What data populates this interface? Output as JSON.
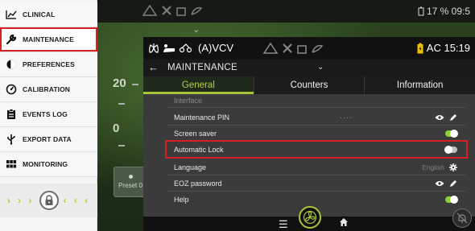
{
  "background_screen": {
    "status_text": "17 % 09:5",
    "gauge_numbers": [
      "20",
      "0"
    ],
    "preset_label": "Preset 0"
  },
  "left_menu": {
    "items": [
      {
        "label": "CLINICAL",
        "icon": "line-chart-icon"
      },
      {
        "label": "MAINTENANCE",
        "icon": "wrench-icon",
        "active": true
      },
      {
        "label": "PREFERENCES",
        "icon": "preferences-icon"
      },
      {
        "label": "CALIBRATION",
        "icon": "calibration-icon"
      },
      {
        "label": "EVENTS LOG",
        "icon": "clipboard-icon"
      },
      {
        "label": "EXPORT DATA",
        "icon": "usb-icon"
      },
      {
        "label": "MONITORING",
        "icon": "grid-icon"
      }
    ],
    "lock": {
      "left_chevrons": "› › ›",
      "right_chevrons": "‹ ‹ ‹"
    }
  },
  "panel": {
    "status_bar": {
      "mode": "(A)VCV",
      "power": "AC 15:19"
    },
    "title": "MAINTENANCE",
    "tabs": [
      {
        "label": "General",
        "active": true
      },
      {
        "label": "Counters",
        "active": false
      },
      {
        "label": "Information",
        "active": false
      }
    ],
    "rows": [
      {
        "label": "Interface",
        "muted": true
      },
      {
        "label": "Maintenance PIN",
        "mid": "····",
        "controls": [
          "eye-icon",
          "pencil-icon"
        ]
      },
      {
        "label": "Screen saver",
        "toggle": "on"
      },
      {
        "label": "Automatic Lock",
        "toggle": "off",
        "highlighted": true
      },
      {
        "label": "Language",
        "value": "English",
        "controls": [
          "gear-icon"
        ]
      },
      {
        "label": "EOZ password",
        "controls": [
          "eye-icon",
          "pencil-icon"
        ]
      },
      {
        "label": "Help",
        "toggle": "on"
      }
    ]
  },
  "colors": {
    "accent_green": "#a8c43a",
    "highlight_red": "#d81f26",
    "toggle_on": "#8bd12a",
    "toggle_off": "#bdbdbd"
  }
}
